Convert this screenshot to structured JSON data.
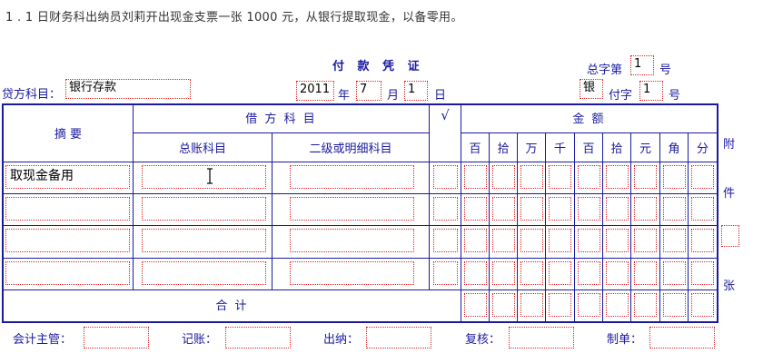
{
  "instruction": "1 . 1 日财务科出纳员刘莉开出现金支票一张 1000 元，从银行提取现金，以备零用。",
  "voucher": {
    "title": "付 款 凭 证",
    "total_no_label": "总字第",
    "total_no_value": "1",
    "hao1": "号",
    "credit_account_label": "贷方科目：",
    "credit_account_value": "银行存款",
    "year": "2011",
    "year_label": "年",
    "month": "7",
    "month_label": "月",
    "day": "1",
    "day_label": "日",
    "type_char": "银",
    "fu_label": "付字",
    "fu_value": "1",
    "hao2": "号"
  },
  "table": {
    "summary_header": "摘 要",
    "debit_header": "借 方 科 目",
    "gl_header": "总账科目",
    "sub_header": "二级或明细科目",
    "check_header": "√",
    "amount_header": "金 额",
    "digit_headers": [
      "百",
      "拾",
      "万",
      "千",
      "百",
      "拾",
      "元",
      "角",
      "分"
    ],
    "rows": [
      {
        "summary": "取现金备用",
        "gl": "",
        "sub": ""
      },
      {
        "summary": "",
        "gl": "",
        "sub": ""
      },
      {
        "summary": "",
        "gl": "",
        "sub": ""
      },
      {
        "summary": "",
        "gl": "",
        "sub": ""
      }
    ],
    "total_label": "合 计"
  },
  "attach": {
    "fu": "附",
    "jian": "件",
    "zhang": "张"
  },
  "signatures": {
    "supervisor": "会计主管：",
    "bookkeeping": "记账：",
    "cashier": "出纳：",
    "review": "复核：",
    "maker": "制单："
  }
}
